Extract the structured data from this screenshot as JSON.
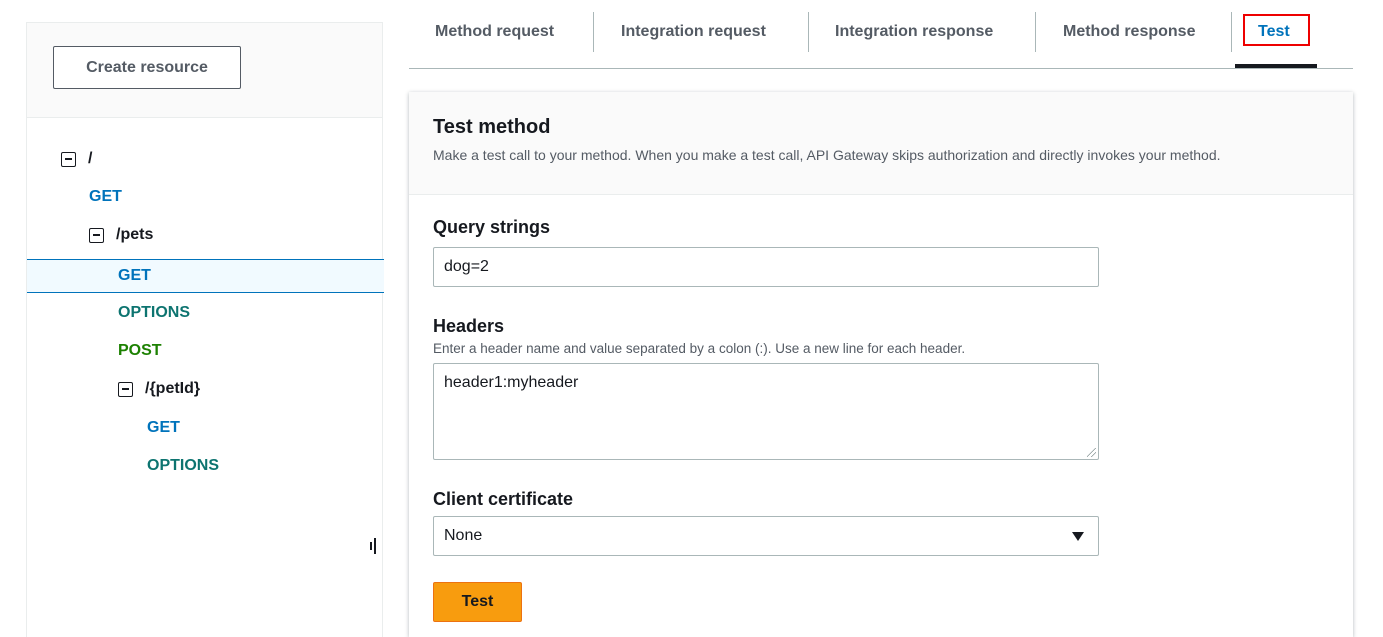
{
  "sidebar": {
    "create_button_label": "Create resource",
    "tree": [
      {
        "kind": "resource",
        "label": "/"
      },
      {
        "kind": "method",
        "label": "GET"
      },
      {
        "kind": "resource",
        "label": "/pets"
      },
      {
        "kind": "method",
        "label": "GET",
        "selected": true
      },
      {
        "kind": "method",
        "label": "OPTIONS"
      },
      {
        "kind": "method",
        "label": "POST"
      },
      {
        "kind": "resource",
        "label": "/{petId}"
      },
      {
        "kind": "method",
        "label": "GET"
      },
      {
        "kind": "method",
        "label": "OPTIONS"
      }
    ]
  },
  "tabs": [
    {
      "label": "Method request"
    },
    {
      "label": "Integration request"
    },
    {
      "label": "Integration response"
    },
    {
      "label": "Method response"
    },
    {
      "label": "Test",
      "active": true
    }
  ],
  "test_method": {
    "title": "Test method",
    "description": "Make a test call to your method. When you make a test call, API Gateway skips authorization and directly invokes your method.",
    "query_strings": {
      "label": "Query strings",
      "value": "dog=2"
    },
    "headers": {
      "label": "Headers",
      "description": "Enter a header name and value separated by a colon (:). Use a new line for each header.",
      "value": "header1:myheader"
    },
    "client_certificate": {
      "label": "Client certificate",
      "selected": "None"
    },
    "submit_label": "Test"
  },
  "colors": {
    "get_method": "#0073bb",
    "options_method": "#0d7470",
    "post_method": "#1d8102",
    "primary_button": "#f89c0e",
    "tab_highlight": "#ee0000"
  }
}
